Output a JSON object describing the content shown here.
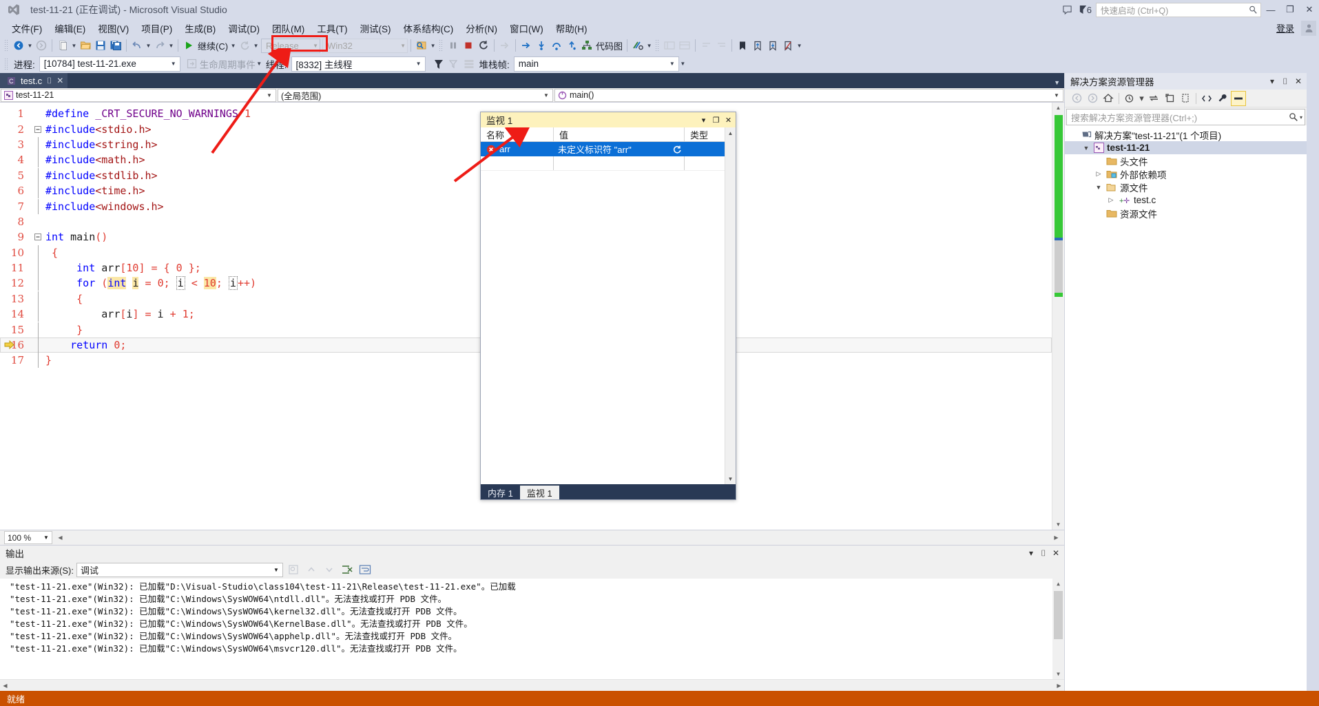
{
  "window": {
    "title": "test-11-21 (正在调试) - Microsoft Visual Studio",
    "minimize": "—",
    "maximize": "❐",
    "close": "✕",
    "notification_count": "6",
    "quick_launch_placeholder": "快速启动 (Ctrl+Q)",
    "signin": "登录"
  },
  "menubar": {
    "items": [
      {
        "label": "文件(F)"
      },
      {
        "label": "编辑(E)"
      },
      {
        "label": "视图(V)"
      },
      {
        "label": "项目(P)"
      },
      {
        "label": "生成(B)"
      },
      {
        "label": "调试(D)"
      },
      {
        "label": "团队(M)"
      },
      {
        "label": "工具(T)"
      },
      {
        "label": "测试(S)"
      },
      {
        "label": "体系结构(C)"
      },
      {
        "label": "分析(N)"
      },
      {
        "label": "窗口(W)"
      },
      {
        "label": "帮助(H)"
      }
    ]
  },
  "toolbar": {
    "continue_label": "继续(C)",
    "config": "Release",
    "platform": "Win32",
    "code_map_label": "代码图"
  },
  "debugbar": {
    "process_label": "进程:",
    "process_value": "[10784] test-11-21.exe",
    "lifecycle_label": "生命周期事件",
    "thread_label": "线程:",
    "thread_value": "[8332] 主线程",
    "stack_label": "堆栈帧:",
    "stack_value": "main"
  },
  "editor": {
    "tab_name": "test.c",
    "nav_project": "test-11-21",
    "nav_scope": "(全局范围)",
    "nav_function": "main()",
    "zoom": "100 %",
    "lines": [
      {
        "n": "1",
        "fold": "",
        "changed": false,
        "tokens": [
          {
            "t": "#define ",
            "c": "pp"
          },
          {
            "t": "_CRT_SECURE_NO_WARNINGS",
            "c": "macro"
          },
          {
            "t": " ",
            "c": "plain"
          },
          {
            "t": "1",
            "c": "pun"
          }
        ]
      },
      {
        "n": "2",
        "fold": "minus",
        "changed": false,
        "tokens": [
          {
            "t": "#include",
            "c": "pp"
          },
          {
            "t": "<stdio.h>",
            "c": "str"
          }
        ]
      },
      {
        "n": "3",
        "fold": "",
        "changed": false,
        "tokens": [
          {
            "t": "#include",
            "c": "pp"
          },
          {
            "t": "<string.h>",
            "c": "str"
          }
        ]
      },
      {
        "n": "4",
        "fold": "",
        "changed": false,
        "tokens": [
          {
            "t": "#include",
            "c": "pp"
          },
          {
            "t": "<math.h>",
            "c": "str"
          }
        ]
      },
      {
        "n": "5",
        "fold": "",
        "changed": false,
        "tokens": [
          {
            "t": "#include",
            "c": "pp"
          },
          {
            "t": "<stdlib.h>",
            "c": "str"
          }
        ]
      },
      {
        "n": "6",
        "fold": "",
        "changed": false,
        "tokens": [
          {
            "t": "#include",
            "c": "pp"
          },
          {
            "t": "<time.h>",
            "c": "str"
          }
        ]
      },
      {
        "n": "7",
        "fold": "",
        "changed": true,
        "tokens": [
          {
            "t": "#include",
            "c": "pp"
          },
          {
            "t": "<windows.h>",
            "c": "str"
          }
        ]
      },
      {
        "n": "8",
        "fold": "",
        "changed": true,
        "tokens": []
      },
      {
        "n": "9",
        "fold": "minus",
        "changed": true,
        "tokens": [
          {
            "t": "int",
            "c": "kw"
          },
          {
            "t": " main",
            "c": "plain"
          },
          {
            "t": "()",
            "c": "pun"
          }
        ]
      },
      {
        "n": "10",
        "fold": "",
        "changed": true,
        "tokens": [
          {
            "t": " ",
            "c": "plain"
          },
          {
            "t": "{",
            "c": "pun"
          }
        ]
      },
      {
        "n": "11",
        "fold": "",
        "changed": true,
        "tokens": [
          {
            "t": "     ",
            "c": "plain"
          },
          {
            "t": "int",
            "c": "kw"
          },
          {
            "t": " arr",
            "c": "plain"
          },
          {
            "t": "[",
            "c": "pun"
          },
          {
            "t": "10",
            "c": "pun"
          },
          {
            "t": "]",
            "c": "pun"
          },
          {
            "t": " ",
            "c": "plain"
          },
          {
            "t": "=",
            "c": "pun"
          },
          {
            "t": " ",
            "c": "plain"
          },
          {
            "t": "{",
            "c": "pun"
          },
          {
            "t": " ",
            "c": "plain"
          },
          {
            "t": "0",
            "c": "pun"
          },
          {
            "t": " ",
            "c": "plain"
          },
          {
            "t": "}",
            "c": "pun"
          },
          {
            "t": ";",
            "c": "pun"
          }
        ]
      },
      {
        "n": "12",
        "fold": "",
        "changed": true,
        "tokens": [
          {
            "t": "     ",
            "c": "plain"
          },
          {
            "t": "for",
            "c": "kw"
          },
          {
            "t": " ",
            "c": "plain"
          },
          {
            "t": "(",
            "c": "pun"
          },
          {
            "t": "int",
            "c": "kw hl"
          },
          {
            "t": " ",
            "c": "plain"
          },
          {
            "t": "i",
            "c": "plain hl"
          },
          {
            "t": " ",
            "c": "plain"
          },
          {
            "t": "=",
            "c": "pun"
          },
          {
            "t": " ",
            "c": "plain"
          },
          {
            "t": "0",
            "c": "pun"
          },
          {
            "t": ";",
            "c": "pun"
          },
          {
            "t": " ",
            "c": "plain"
          },
          {
            "t": "i",
            "c": "plain dotbox"
          },
          {
            "t": " ",
            "c": "plain"
          },
          {
            "t": "<",
            "c": "pun"
          },
          {
            "t": " ",
            "c": "plain"
          },
          {
            "t": "10",
            "c": "pun hl"
          },
          {
            "t": ";",
            "c": "pun"
          },
          {
            "t": " ",
            "c": "plain"
          },
          {
            "t": "i",
            "c": "plain dotbox"
          },
          {
            "t": "++",
            "c": "pun"
          },
          {
            "t": ")",
            "c": "pun"
          }
        ]
      },
      {
        "n": "13",
        "fold": "",
        "changed": true,
        "tokens": [
          {
            "t": "     ",
            "c": "plain"
          },
          {
            "t": "{",
            "c": "pun"
          }
        ]
      },
      {
        "n": "14",
        "fold": "",
        "changed": true,
        "tokens": [
          {
            "t": "         ",
            "c": "plain"
          },
          {
            "t": "arr",
            "c": "plain"
          },
          {
            "t": "[",
            "c": "pun"
          },
          {
            "t": "i",
            "c": "plain"
          },
          {
            "t": "]",
            "c": "pun"
          },
          {
            "t": " ",
            "c": "plain"
          },
          {
            "t": "=",
            "c": "pun"
          },
          {
            "t": " i ",
            "c": "plain"
          },
          {
            "t": "+",
            "c": "pun"
          },
          {
            "t": " ",
            "c": "plain"
          },
          {
            "t": "1",
            "c": "pun"
          },
          {
            "t": ";",
            "c": "pun"
          }
        ]
      },
      {
        "n": "15",
        "fold": "",
        "changed": true,
        "tokens": [
          {
            "t": "     ",
            "c": "plain"
          },
          {
            "t": "}",
            "c": "pun"
          }
        ]
      },
      {
        "n": "16",
        "fold": "",
        "changed": true,
        "current": true,
        "tokens": [
          {
            "t": "    ",
            "c": "plain"
          },
          {
            "t": "return",
            "c": "kw"
          },
          {
            "t": " ",
            "c": "plain"
          },
          {
            "t": "0",
            "c": "pun"
          },
          {
            "t": ";",
            "c": "pun"
          }
        ]
      },
      {
        "n": "17",
        "fold": "",
        "changed": true,
        "tokens": [
          {
            "t": "}",
            "c": "pun"
          }
        ]
      }
    ]
  },
  "watch": {
    "title": "监视 1",
    "columns": [
      "名称",
      "值",
      "类型"
    ],
    "rows": [
      {
        "name": "arr",
        "value": "未定义标识符 \"arr\"",
        "type": "",
        "error": true,
        "selected": true
      }
    ],
    "tabs": [
      {
        "label": "内存 1",
        "active": false
      },
      {
        "label": "监视 1",
        "active": true
      }
    ]
  },
  "solution_explorer": {
    "title": "解决方案资源管理器",
    "search_placeholder": "搜索解决方案资源管理器(Ctrl+;)",
    "tree": [
      {
        "label": "解决方案\"test-11-21\"(1 个项目)",
        "indent": 0,
        "expander": "",
        "icon": "solution-icon",
        "bold": false,
        "selected": false
      },
      {
        "label": "test-11-21",
        "indent": 1,
        "expander": "▲",
        "icon": "project-icon",
        "bold": true,
        "selected": true
      },
      {
        "label": "头文件",
        "indent": 2,
        "expander": "",
        "icon": "folder-icon",
        "bold": false,
        "selected": false
      },
      {
        "label": "外部依赖项",
        "indent": 2,
        "expander": "▷",
        "icon": "folder-ext-icon",
        "bold": false,
        "selected": false
      },
      {
        "label": "源文件",
        "indent": 2,
        "expander": "▲",
        "icon": "folder-open-icon",
        "bold": false,
        "selected": false
      },
      {
        "label": "test.c",
        "indent": 3,
        "expander": "▷",
        "icon": "c-file-icon",
        "bold": false,
        "selected": false
      },
      {
        "label": "资源文件",
        "indent": 2,
        "expander": "",
        "icon": "folder-icon",
        "bold": false,
        "selected": false
      }
    ]
  },
  "output": {
    "title": "输出",
    "source_label": "显示输出来源(S):",
    "source_value": "调试",
    "lines": [
      "\"test-11-21.exe\"(Win32): 已加载\"D:\\Visual-Studio\\class104\\test-11-21\\Release\\test-11-21.exe\"。已加载",
      "\"test-11-21.exe\"(Win32): 已加载\"C:\\Windows\\SysWOW64\\ntdll.dll\"。无法查找或打开 PDB 文件。",
      "\"test-11-21.exe\"(Win32): 已加载\"C:\\Windows\\SysWOW64\\kernel32.dll\"。无法查找或打开 PDB 文件。",
      "\"test-11-21.exe\"(Win32): 已加载\"C:\\Windows\\SysWOW64\\KernelBase.dll\"。无法查找或打开 PDB 文件。",
      "\"test-11-21.exe\"(Win32): 已加载\"C:\\Windows\\SysWOW64\\apphelp.dll\"。无法查找或打开 PDB 文件。",
      "\"test-11-21.exe\"(Win32): 已加载\"C:\\Windows\\SysWOW64\\msvcr120.dll\"。无法查找或打开 PDB 文件。"
    ]
  },
  "statusbar": {
    "text": "就绪"
  },
  "colors": {
    "accent": "#ee1c16",
    "title_bg": "#d6dbe9",
    "status_bg": "#ca5100",
    "watch_title_bg": "#fdf2bd",
    "selection_blue": "#0b6fd6"
  }
}
